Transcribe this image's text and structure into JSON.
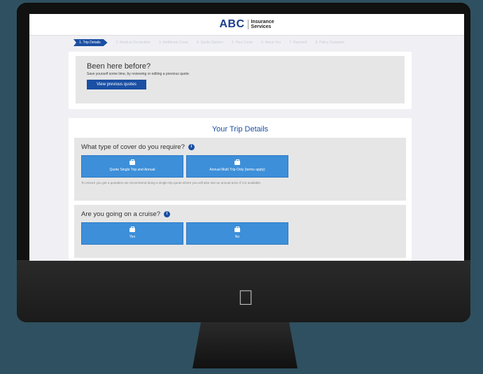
{
  "brand": {
    "abc": "ABC",
    "insurance": "Insurance",
    "services": "Services"
  },
  "steps": [
    "1. Trip Details",
    "2. Medical Declaration",
    "3. Additional Cover",
    "4. Quote Options",
    "5. Your Cover",
    "6. About You",
    "7. Payment",
    "8. Policy Complete"
  ],
  "been_here": {
    "title": "Been here before?",
    "subtitle": "Save yourself some time, by reviewing or editing a previous quote.",
    "button": "View previous quotes"
  },
  "trip": {
    "title": "Your Trip Details",
    "cover_question": "What type of cover do you require?",
    "cover_options": [
      "Quote Single Trip and Annual",
      "Annual Multi Trip Only (terms apply)"
    ],
    "cover_note": "To ensure you get a quotation we recommend doing a single-trip quote where you will also see an annual price if it is available.",
    "cruise_question": "Are you going on a cruise?",
    "cruise_options": [
      "Yes",
      "No"
    ]
  },
  "colors": {
    "primary": "#1a4fa3",
    "option": "#3d8fd9",
    "page_bg": "#2f5060"
  }
}
